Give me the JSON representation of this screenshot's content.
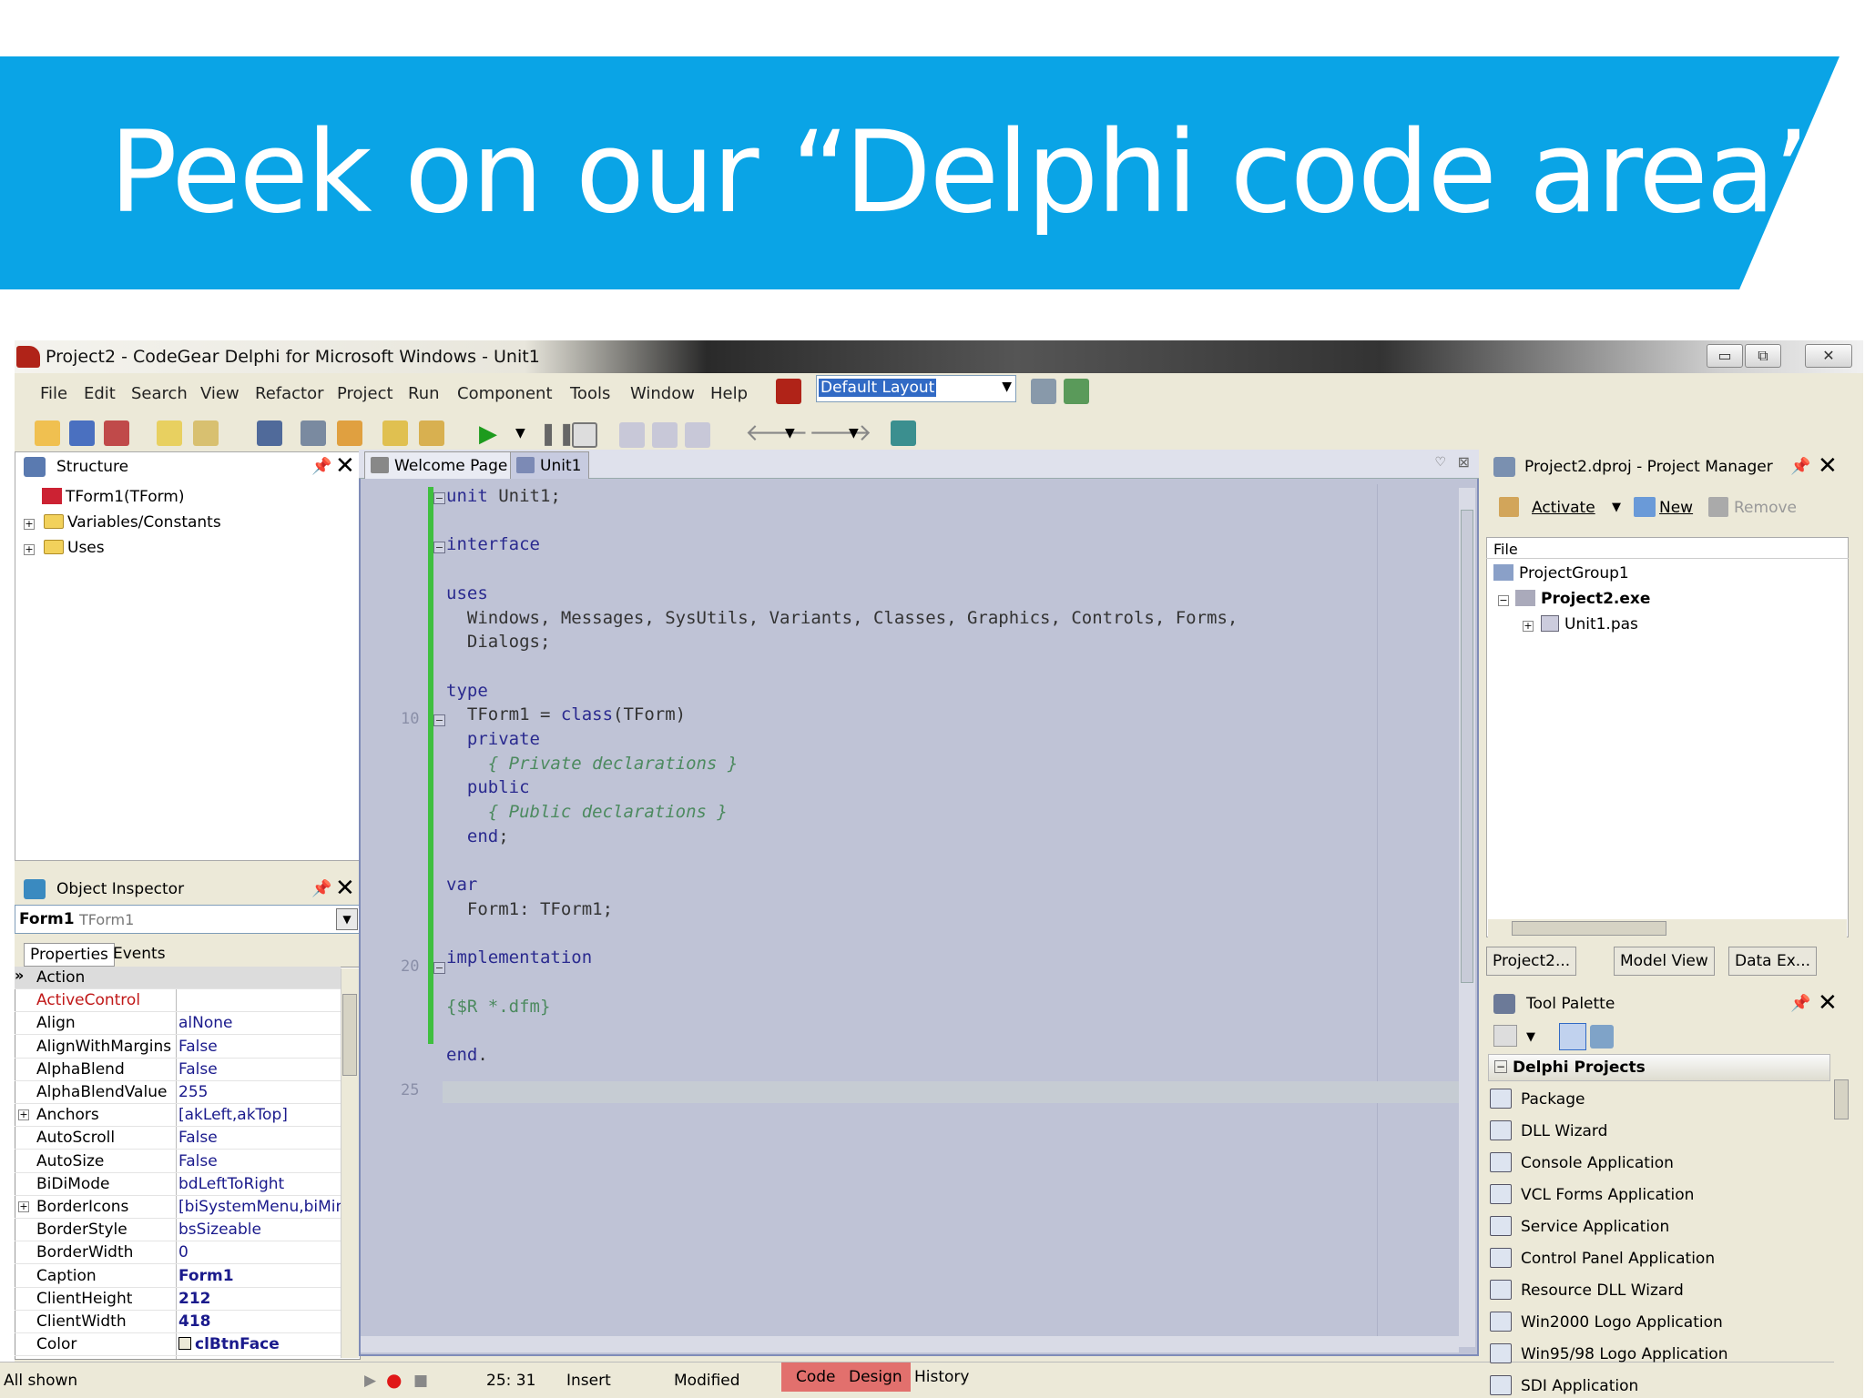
{
  "slide": {
    "title": "Peek on our “Delphi code area”"
  },
  "window": {
    "title": "Project2 - CodeGear Delphi for Microsoft Windows - Unit1"
  },
  "menu": [
    "File",
    "Edit",
    "Search",
    "View",
    "Refactor",
    "Project",
    "Run",
    "Component",
    "Tools",
    "Window",
    "Help"
  ],
  "layout_combo": {
    "value": "Default Layout"
  },
  "structure": {
    "title": "Structure",
    "items": [
      "TForm1(TForm)",
      "Variables/Constants",
      "Uses"
    ]
  },
  "object_inspector": {
    "title": "Object Inspector",
    "selected": "Form1",
    "selected_type": "TForm1",
    "tabs": [
      "Properties",
      "Events"
    ],
    "props": [
      {
        "name": "Action",
        "value": ""
      },
      {
        "name": "ActiveControl",
        "value": ""
      },
      {
        "name": "Align",
        "value": "alNone"
      },
      {
        "name": "AlignWithMargins",
        "value": "False"
      },
      {
        "name": "AlphaBlend",
        "value": "False"
      },
      {
        "name": "AlphaBlendValue",
        "value": "255"
      },
      {
        "name": "Anchors",
        "value": "[akLeft,akTop]"
      },
      {
        "name": "AutoScroll",
        "value": "False"
      },
      {
        "name": "AutoSize",
        "value": "False"
      },
      {
        "name": "BiDiMode",
        "value": "bdLeftToRight"
      },
      {
        "name": "BorderIcons",
        "value": "[biSystemMenu,biMinim"
      },
      {
        "name": "BorderStyle",
        "value": "bsSizeable"
      },
      {
        "name": "BorderWidth",
        "value": "0"
      },
      {
        "name": "Caption",
        "value": "Form1"
      },
      {
        "name": "ClientHeight",
        "value": "212"
      },
      {
        "name": "ClientWidth",
        "value": "418"
      },
      {
        "name": "Color",
        "value": "clBtnFace"
      }
    ],
    "footer": "All shown"
  },
  "editor": {
    "tabs": [
      "Welcome Page",
      "Unit1"
    ],
    "line_numbers": [
      "10",
      "20",
      "25"
    ],
    "status": {
      "position": "25: 31",
      "mode": "Insert",
      "state": "Modified"
    },
    "view_tabs": [
      "Code",
      "Design",
      "History"
    ]
  },
  "project_manager": {
    "title": "Project2.dproj - Project Manager",
    "buttons": [
      "Activate",
      "New",
      "Remove"
    ],
    "column": "File",
    "tree": [
      "ProjectGroup1",
      "Project2.exe",
      "Unit1.pas"
    ],
    "bottom_tabs": [
      "Project2...",
      "Model View",
      "Data Ex..."
    ]
  },
  "tool_palette": {
    "title": "Tool Palette",
    "category": "Delphi Projects",
    "items": [
      "Package",
      "DLL Wizard",
      "Console Application",
      "VCL Forms Application",
      "Service Application",
      "Control Panel Application",
      "Resource DLL Wizard",
      "Win2000 Logo Application",
      "Win95/98 Logo Application",
      "SDI Application"
    ]
  }
}
